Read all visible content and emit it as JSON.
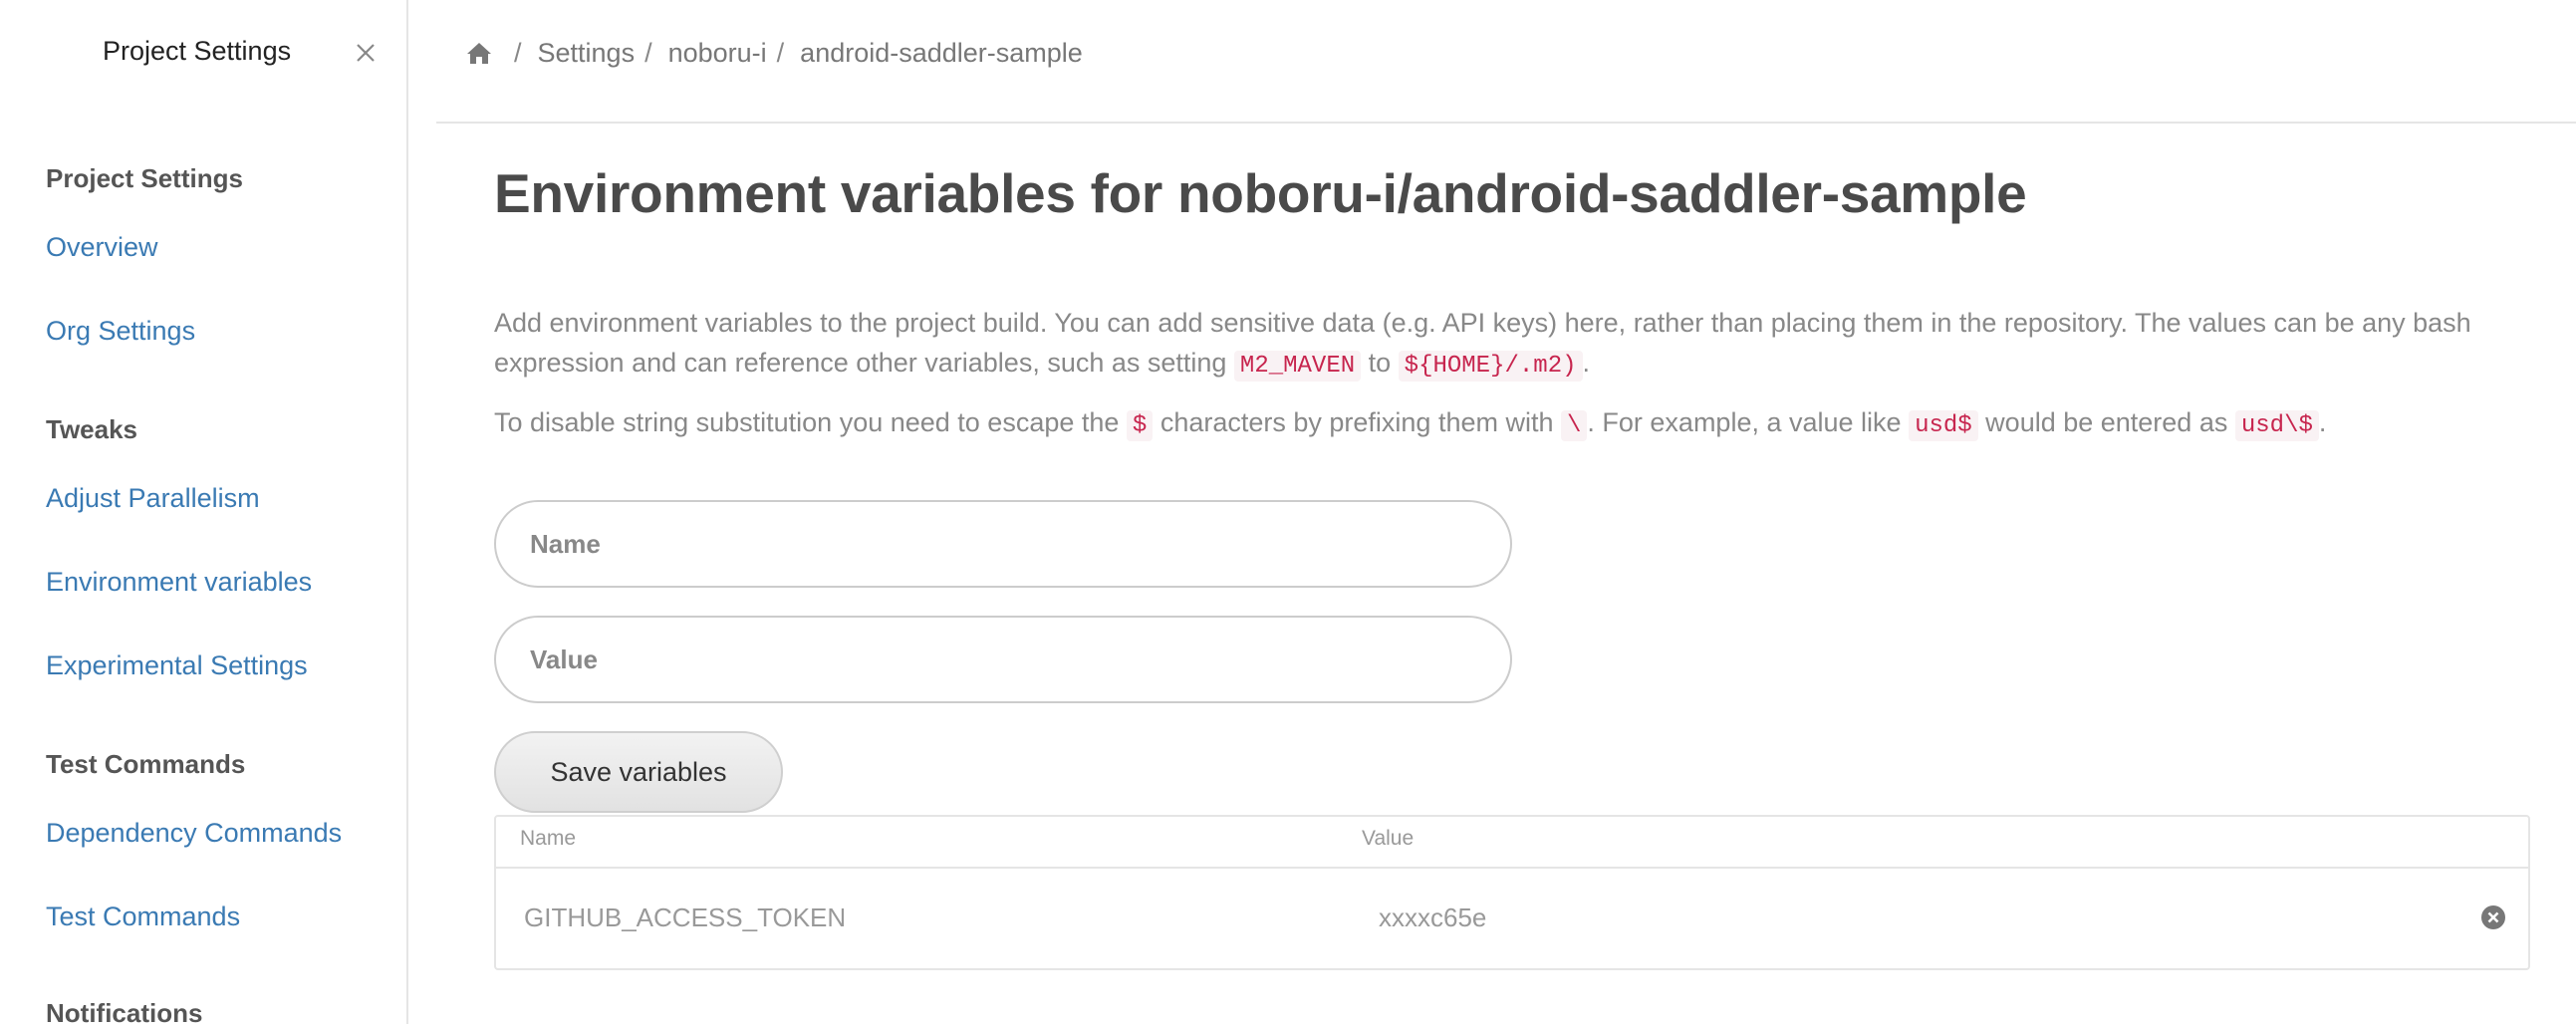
{
  "sidebar": {
    "title": "Project Settings",
    "sections": [
      {
        "heading": "Project Settings",
        "items": [
          "Overview",
          "Org Settings"
        ]
      },
      {
        "heading": "Tweaks",
        "items": [
          "Adjust Parallelism",
          "Environment variables",
          "Experimental Settings"
        ]
      },
      {
        "heading": "Test Commands",
        "items": [
          "Dependency Commands",
          "Test Commands"
        ]
      },
      {
        "heading": "Notifications",
        "items": []
      }
    ]
  },
  "breadcrumb": {
    "home_icon": "home-icon",
    "separator": "/",
    "items": [
      "Settings",
      "noboru-i",
      "android-saddler-sample"
    ]
  },
  "page": {
    "title": "Environment variables for noboru-i/android-saddler-sample",
    "desc1": {
      "text_a": "Add environment variables to the project build. You can add sensitive data (e.g. API keys) here, rather than placing them in the repository. The values can be any bash expression and can reference other variables, such as setting ",
      "code_a": "M2_MAVEN",
      "text_b": " to ",
      "code_b": "${HOME}/.m2)",
      "text_c": "."
    },
    "desc2": {
      "text_a": "To disable string substitution you need to escape the ",
      "code_a": "$",
      "text_b": " characters by prefixing them with ",
      "code_b": "\\",
      "text_c": ". For example, a value like ",
      "code_c": "usd$",
      "text_d": " would be entered as ",
      "code_d": "usd\\$",
      "text_e": "."
    }
  },
  "form": {
    "name_placeholder": "Name",
    "name_value": "",
    "value_placeholder": "Value",
    "value_value": "",
    "save_label": "Save variables"
  },
  "table": {
    "headers": [
      "Name",
      "Value"
    ],
    "rows": [
      {
        "name": "GITHUB_ACCESS_TOKEN",
        "value": "xxxxc65e"
      }
    ]
  },
  "colors": {
    "link": "#3a7ab3",
    "code_text": "#c7254e",
    "code_bg": "#f9f2f4"
  }
}
